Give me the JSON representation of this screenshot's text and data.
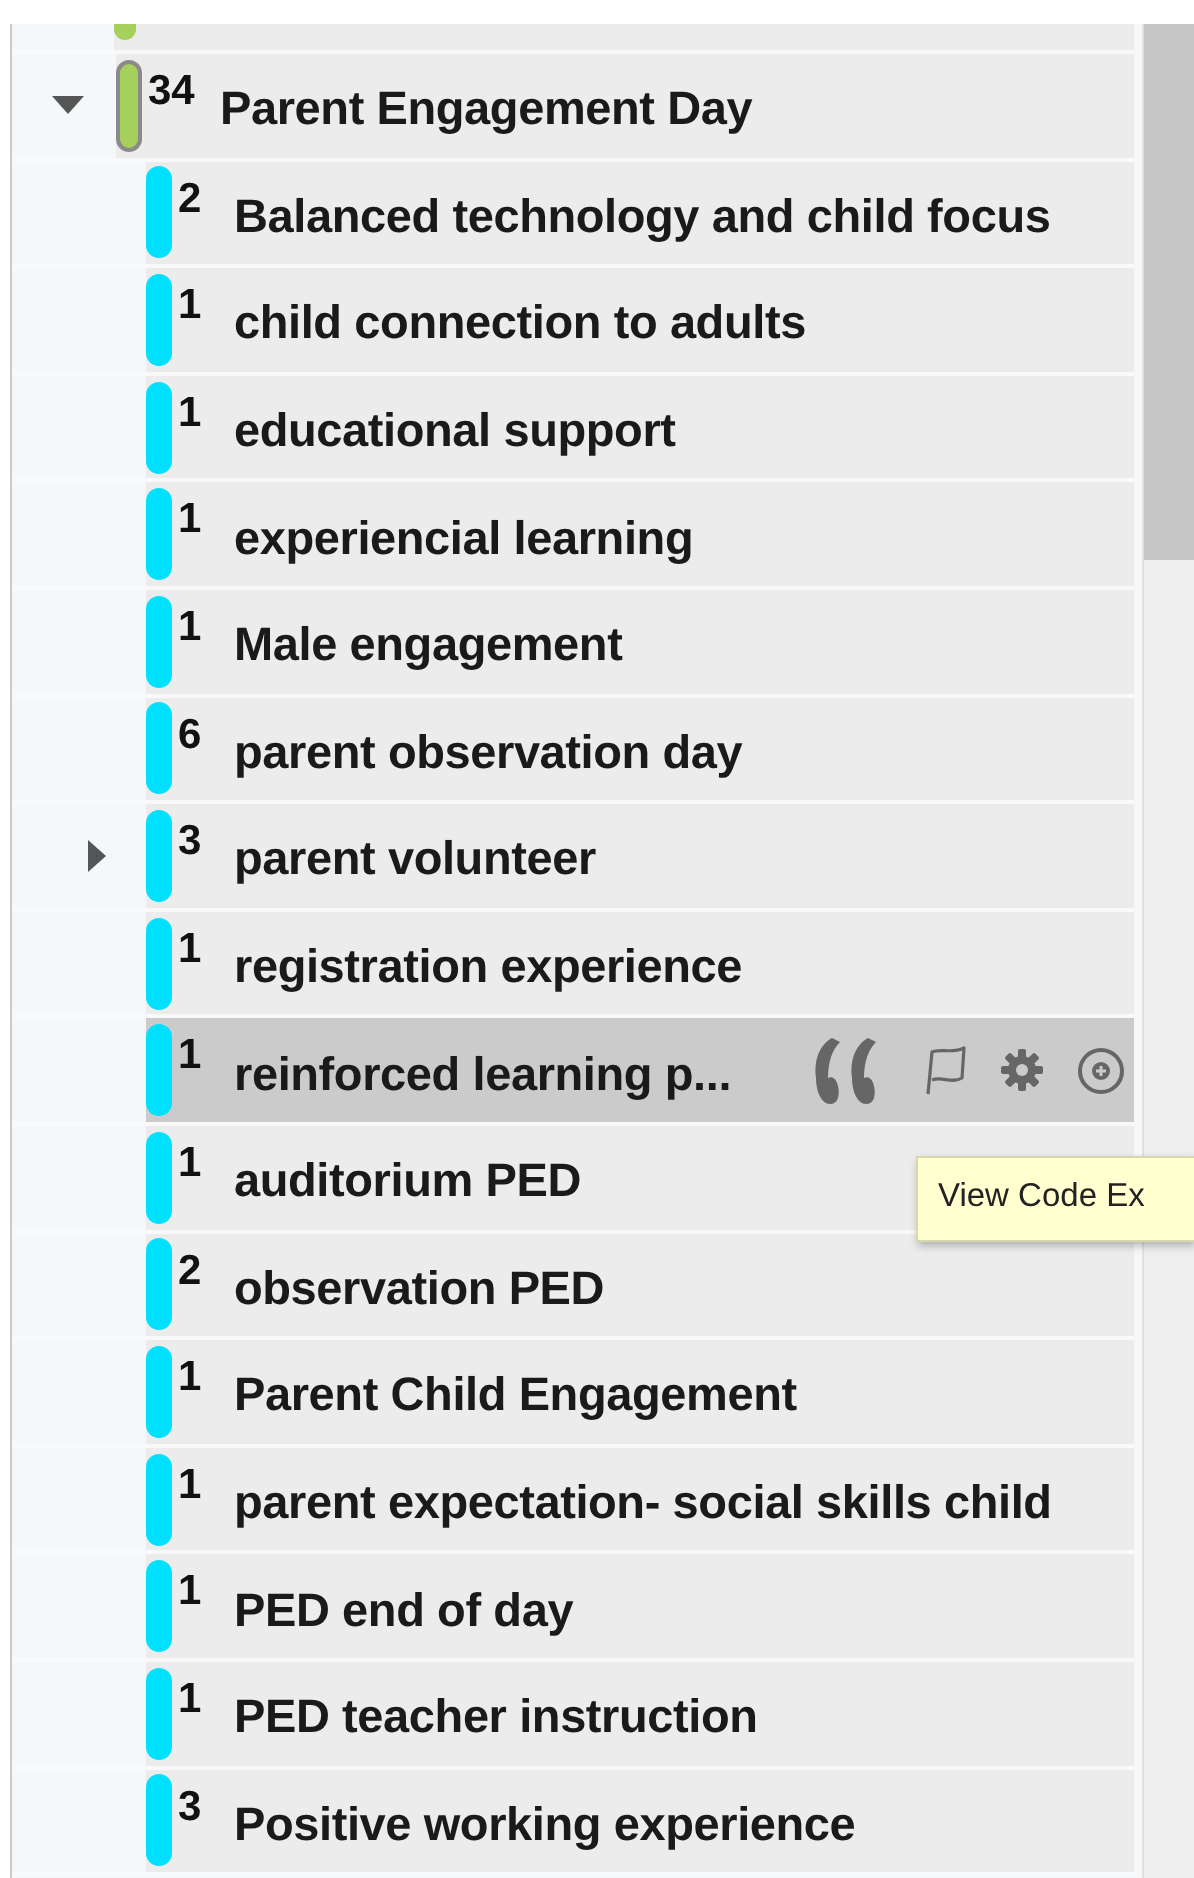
{
  "parent": {
    "count": "34",
    "label": "Parent Engagement Day",
    "expanded": true,
    "color": "#a6d05c"
  },
  "children": [
    {
      "count": "2",
      "label": "Balanced technology and child focus",
      "has_children": false,
      "expanded": false,
      "highlighted": false,
      "color": "#00e1ff"
    },
    {
      "count": "1",
      "label": "child connection to adults",
      "has_children": false,
      "expanded": false,
      "highlighted": false,
      "color": "#00e1ff"
    },
    {
      "count": "1",
      "label": "educational support",
      "has_children": false,
      "expanded": false,
      "highlighted": false,
      "color": "#00e1ff"
    },
    {
      "count": "1",
      "label": "experiencial learning",
      "has_children": false,
      "expanded": false,
      "highlighted": false,
      "color": "#00e1ff"
    },
    {
      "count": "1",
      "label": "Male engagement",
      "has_children": false,
      "expanded": false,
      "highlighted": false,
      "color": "#00e1ff"
    },
    {
      "count": "6",
      "label": "parent observation day",
      "has_children": false,
      "expanded": false,
      "highlighted": false,
      "color": "#00e1ff"
    },
    {
      "count": "3",
      "label": "parent volunteer",
      "has_children": true,
      "expanded": false,
      "highlighted": false,
      "color": "#00e1ff"
    },
    {
      "count": "1",
      "label": "registration experience",
      "has_children": false,
      "expanded": false,
      "highlighted": false,
      "color": "#00e1ff"
    },
    {
      "count": "1",
      "label": "reinforced learning p...",
      "has_children": false,
      "expanded": false,
      "highlighted": true,
      "color": "#00e1ff"
    },
    {
      "count": "1",
      "label": "auditorium PED",
      "has_children": false,
      "expanded": false,
      "highlighted": false,
      "color": "#00e1ff"
    },
    {
      "count": "2",
      "label": "observation PED",
      "has_children": false,
      "expanded": false,
      "highlighted": false,
      "color": "#00e1ff"
    },
    {
      "count": "1",
      "label": "Parent Child Engagement",
      "has_children": false,
      "expanded": false,
      "highlighted": false,
      "color": "#00e1ff"
    },
    {
      "count": "1",
      "label": "parent expectation- social skills child",
      "has_children": false,
      "expanded": false,
      "highlighted": false,
      "color": "#00e1ff"
    },
    {
      "count": "1",
      "label": "PED end of day",
      "has_children": false,
      "expanded": false,
      "highlighted": false,
      "color": "#00e1ff"
    },
    {
      "count": "1",
      "label": "PED teacher instruction",
      "has_children": false,
      "expanded": false,
      "highlighted": false,
      "color": "#00e1ff"
    },
    {
      "count": "3",
      "label": "Positive working experience",
      "has_children": false,
      "expanded": false,
      "highlighted": false,
      "color": "#00e1ff"
    }
  ],
  "tooltip": "View Code Ex"
}
